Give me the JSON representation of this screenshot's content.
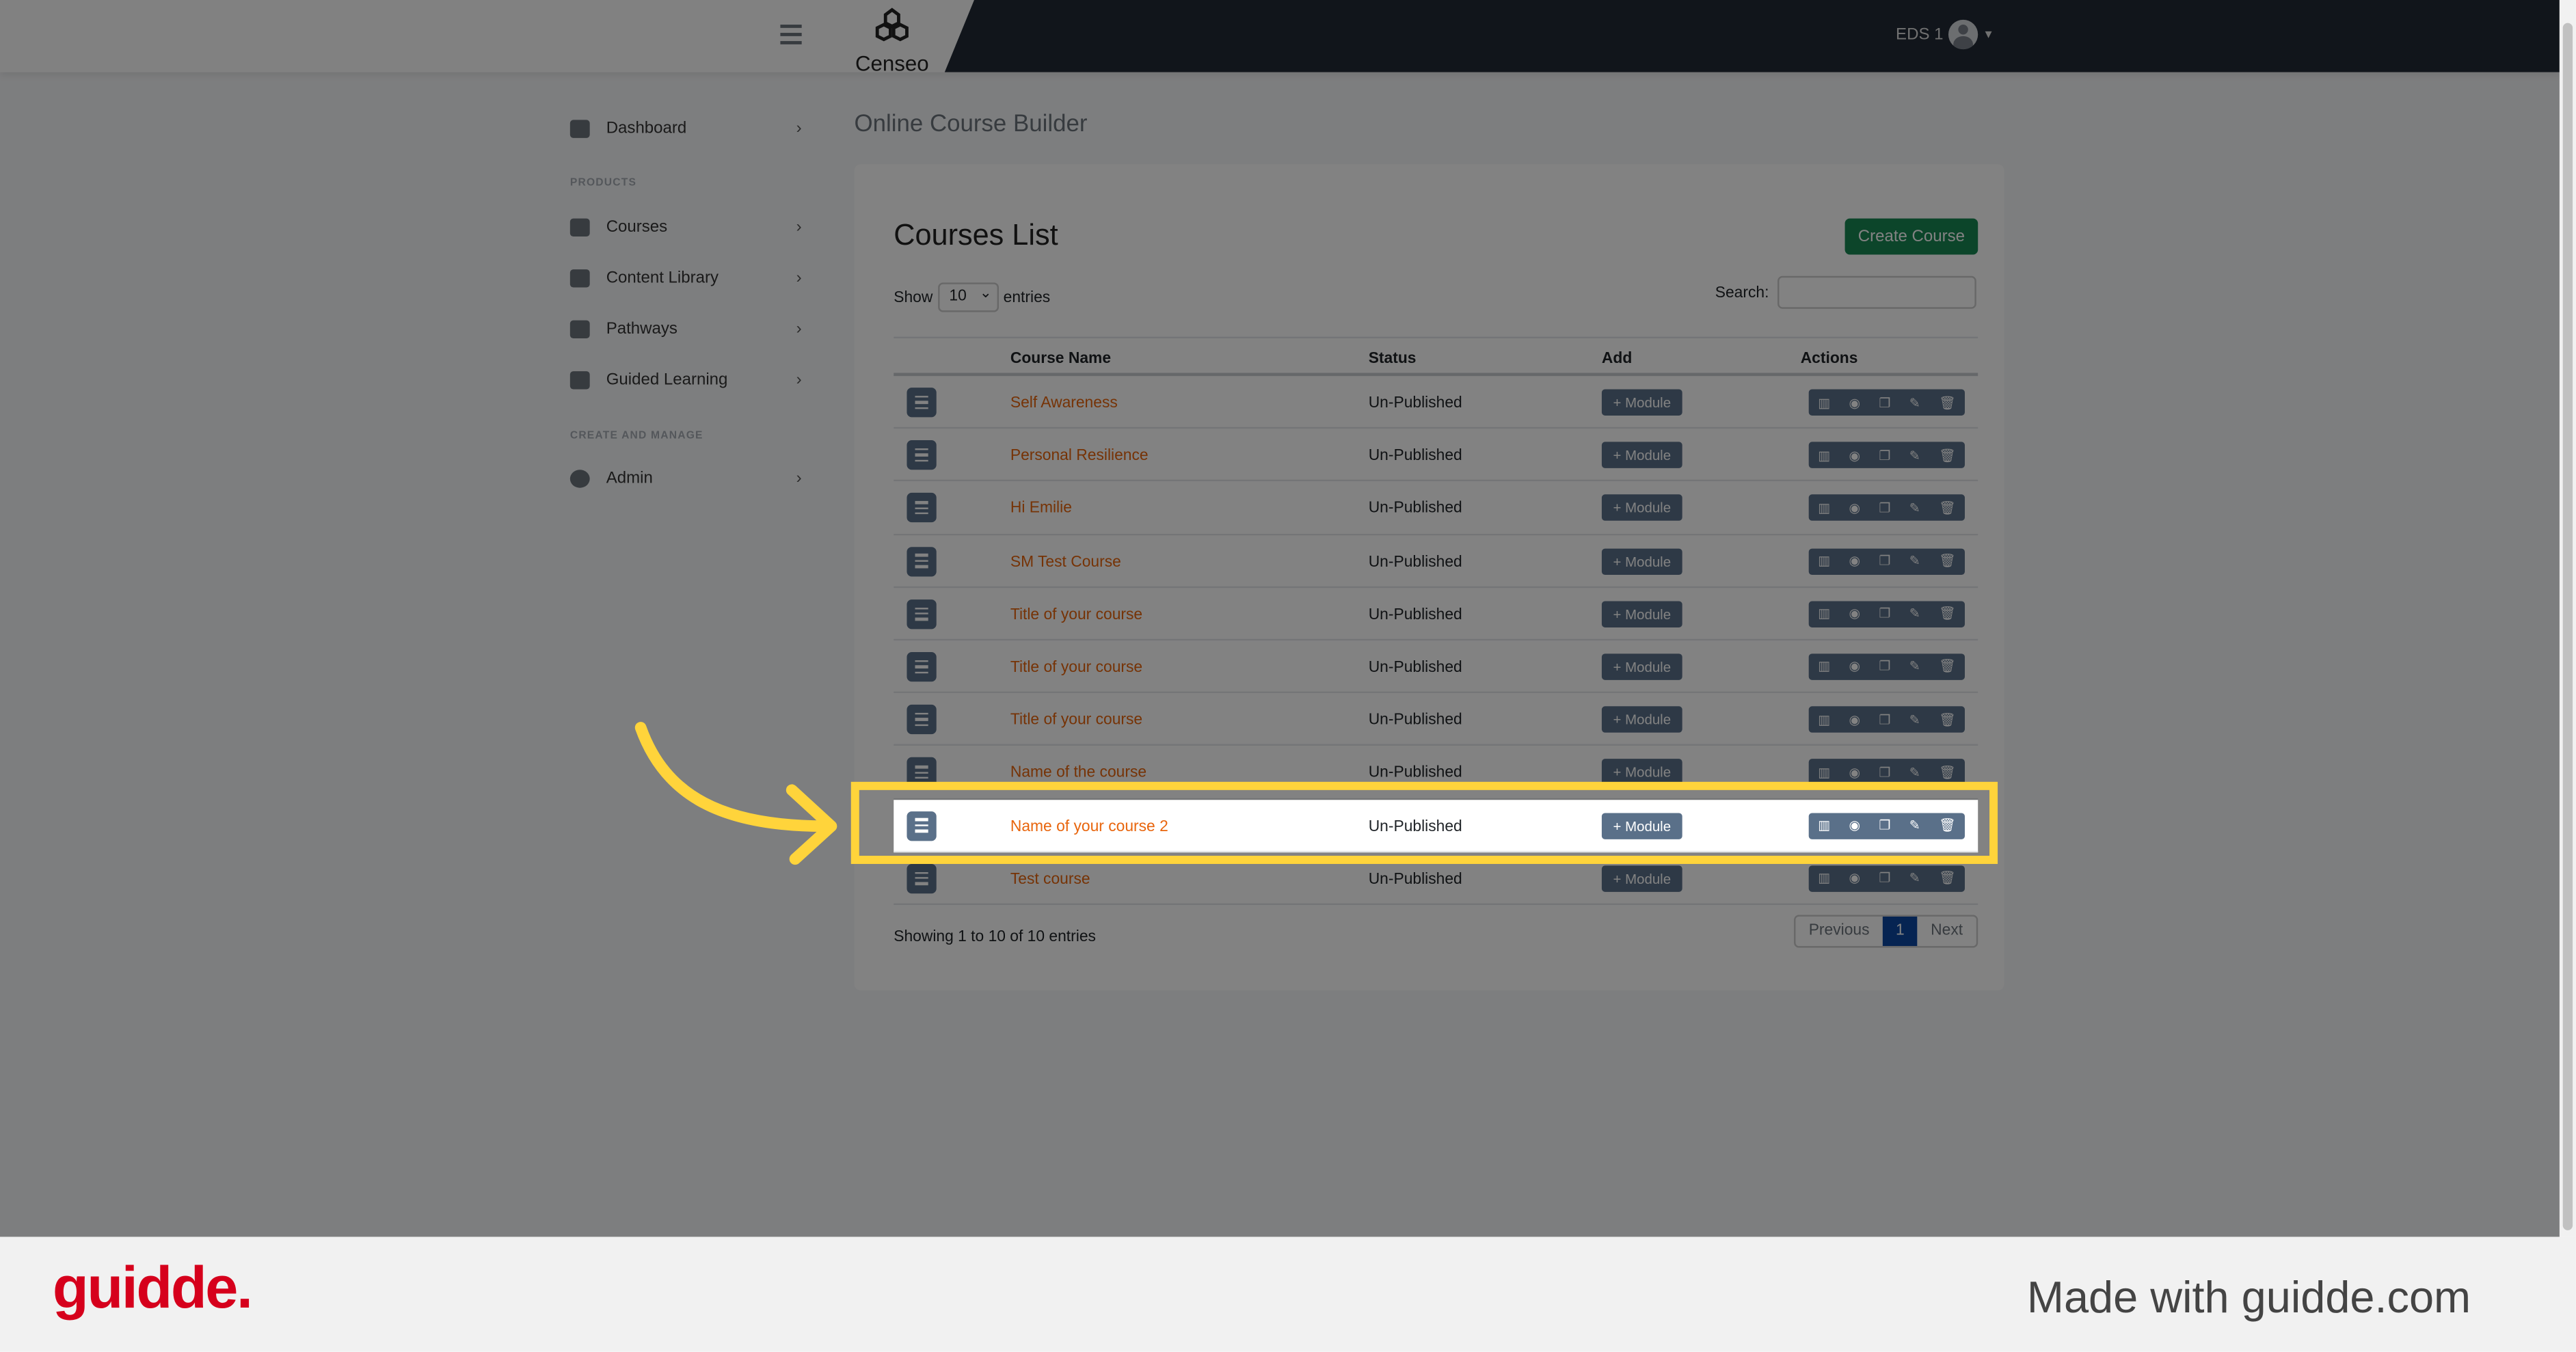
{
  "header": {
    "logo_text": "Censeo",
    "user": "EDS 1"
  },
  "sidebar": {
    "items": [
      {
        "label": "Dashboard"
      },
      {
        "label": "Courses"
      },
      {
        "label": "Content Library"
      },
      {
        "label": "Pathways"
      },
      {
        "label": "Guided Learning"
      },
      {
        "label": "Admin"
      }
    ],
    "sections": [
      "PRODUCTS",
      "CREATE AND MANAGE"
    ]
  },
  "main": {
    "page_title": "Online Course Builder",
    "card_title": "Courses List",
    "create_label": "Create Course",
    "show_label": "Show",
    "entries_value": "10",
    "entries_label": "entries",
    "search_label": "Search:",
    "search_value": "",
    "columns": [
      "Course Name",
      "Status",
      "Add",
      "Actions"
    ],
    "rows": [
      {
        "name": "Self Awareness",
        "status": "Un-Published",
        "add": "+ Module"
      },
      {
        "name": "Personal Resilience",
        "status": "Un-Published",
        "add": "+ Module"
      },
      {
        "name": "Hi Emilie",
        "status": "Un-Published",
        "add": "+ Module"
      },
      {
        "name": "SM Test Course",
        "status": "Un-Published",
        "add": "+ Module"
      },
      {
        "name": "Title of your course",
        "status": "Un-Published",
        "add": "+ Module"
      },
      {
        "name": "Title of your course",
        "status": "Un-Published",
        "add": "+ Module"
      },
      {
        "name": "Title of your course",
        "status": "Un-Published",
        "add": "+ Module"
      },
      {
        "name": "Name of the course",
        "status": "Un-Published",
        "add": "+ Module"
      },
      {
        "name": "Name of your course 2",
        "status": "Un-Published",
        "add": "+ Module",
        "highlighted": true
      },
      {
        "name": "Test course",
        "status": "Un-Published",
        "add": "+ Module"
      }
    ],
    "action_icons": [
      "chart-icon",
      "eye-icon",
      "copy-icon",
      "edit-icon",
      "trash-icon"
    ],
    "footer_info": "Showing 1 to 10 of 10 entries",
    "pager": {
      "previous": "Previous",
      "current": "1",
      "next": "Next"
    }
  },
  "branding": {
    "logo": "guidde.",
    "tagline": "Made with guidde.com"
  },
  "colors": {
    "highlight": "#ffd43b",
    "link": "#e8650d",
    "create": "#198754",
    "header": "#222a36"
  }
}
